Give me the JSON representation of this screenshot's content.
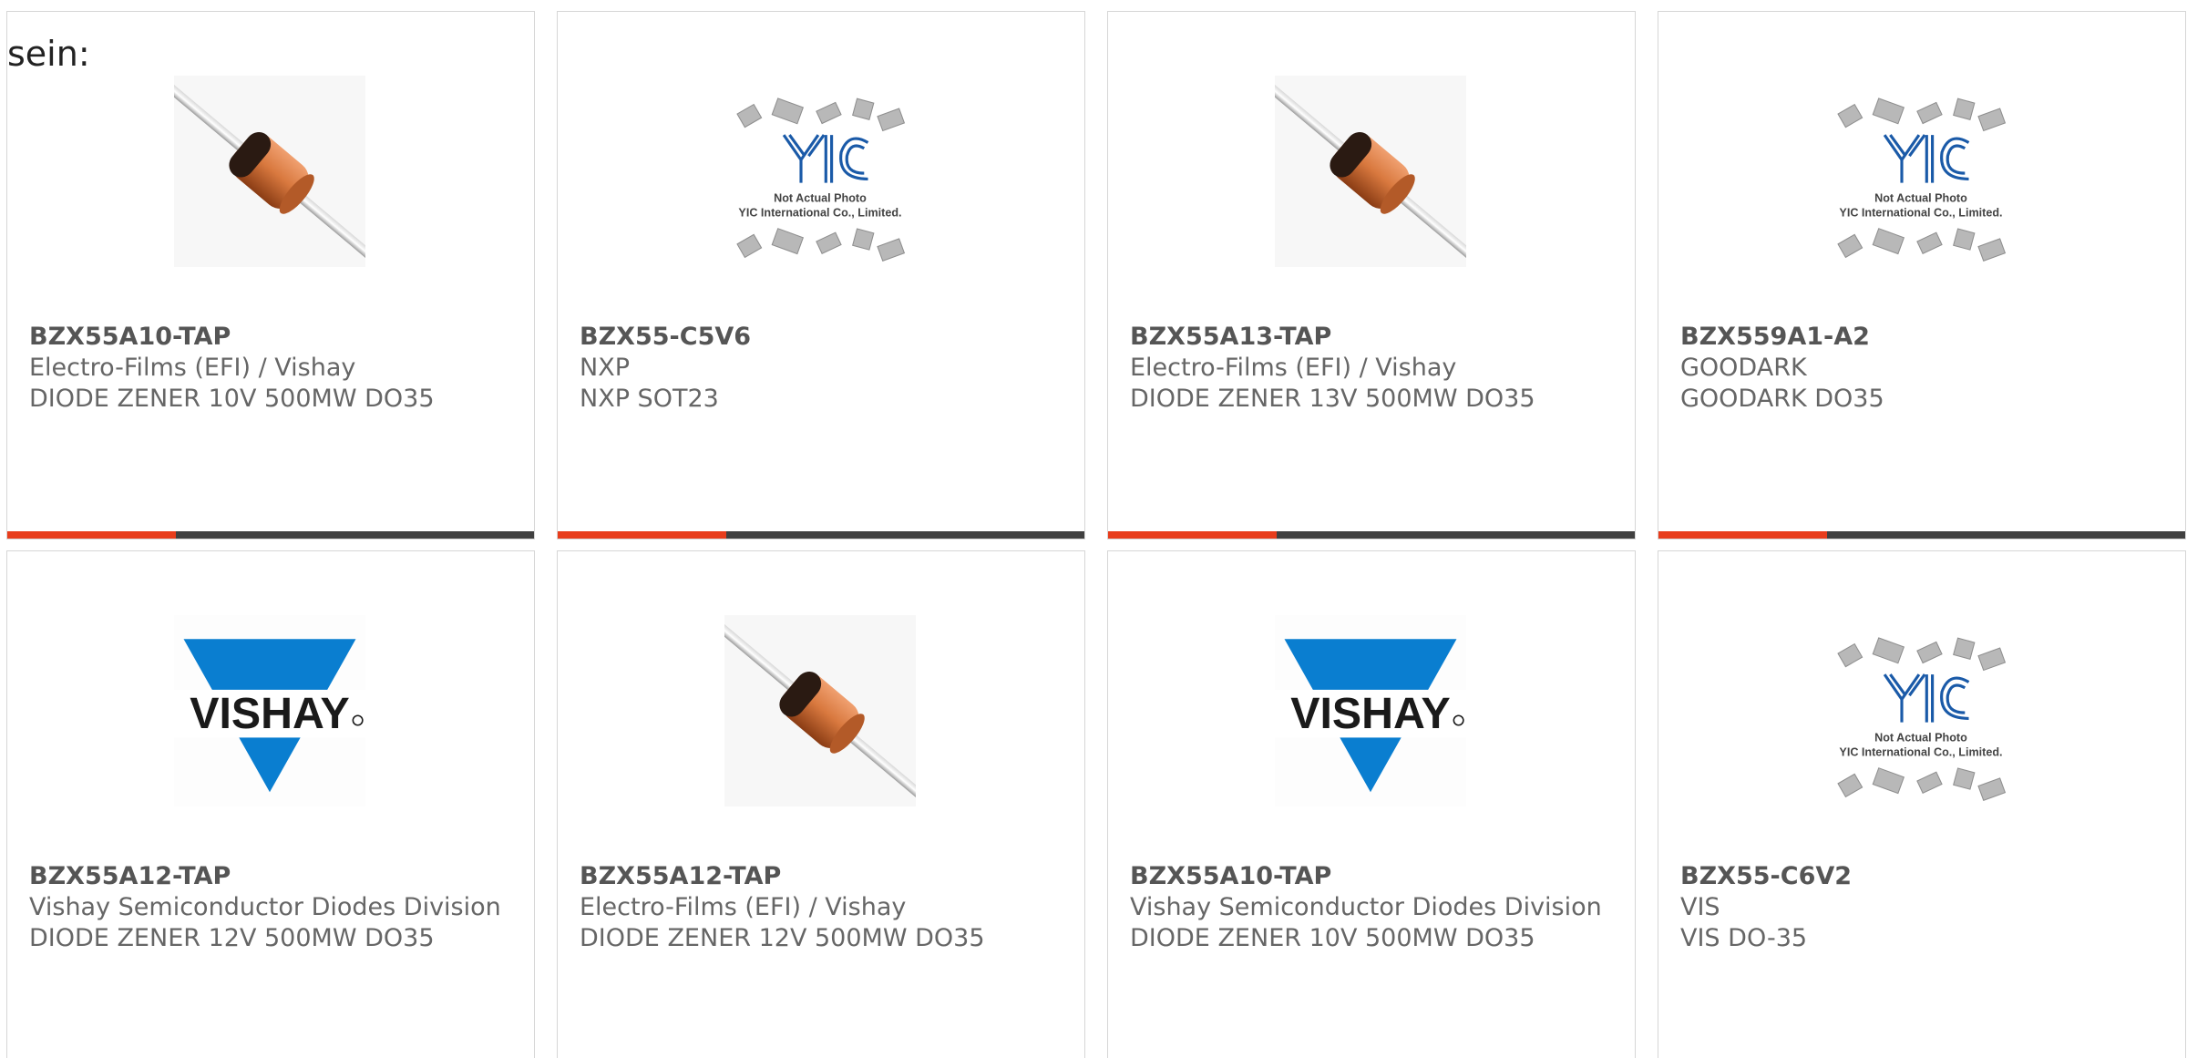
{
  "intro_text": "sein:",
  "colors": {
    "accent": "#e83d1c",
    "bar": "#404040",
    "vishay_blue": "#0a7ed0",
    "yic_blue": "#1a5aa8"
  },
  "cards": [
    {
      "image": "diode-photo",
      "part_number": "BZX55A10-TAP",
      "manufacturer": "Electro-Films (EFI) / Vishay",
      "description": "DIODE ZENER 10V 500MW DO35",
      "accent_fraction": 0.32
    },
    {
      "image": "yic-placeholder",
      "image_caption_1": "Not Actual Photo",
      "image_caption_2": "YIC International Co., Limited.",
      "part_number": "BZX55-C5V6",
      "manufacturer": "NXP",
      "description": "NXP SOT23",
      "accent_fraction": 0.32
    },
    {
      "image": "diode-photo",
      "part_number": "BZX55A13-TAP",
      "manufacturer": "Electro-Films (EFI) / Vishay",
      "description": "DIODE ZENER 13V 500MW DO35",
      "accent_fraction": 0.32
    },
    {
      "image": "yic-placeholder",
      "image_caption_1": "Not Actual Photo",
      "image_caption_2": "YIC International Co., Limited.",
      "part_number": "BZX559A1-A2",
      "manufacturer": "GOODARK",
      "description": "GOODARK DO35",
      "accent_fraction": 0.32
    },
    {
      "image": "vishay-logo",
      "image_caption_1": "VISHAY",
      "part_number": "BZX55A12-TAP",
      "manufacturer": "Vishay Semiconductor Diodes Division",
      "description": "DIODE ZENER 12V 500MW DO35",
      "accent_fraction": 0
    },
    {
      "image": "diode-photo",
      "part_number": "BZX55A12-TAP",
      "manufacturer": "Electro-Films (EFI) / Vishay",
      "description": "DIODE ZENER 12V 500MW DO35",
      "accent_fraction": 0
    },
    {
      "image": "vishay-logo",
      "image_caption_1": "VISHAY",
      "part_number": "BZX55A10-TAP",
      "manufacturer": "Vishay Semiconductor Diodes Division",
      "description": "DIODE ZENER 10V 500MW DO35",
      "accent_fraction": 0
    },
    {
      "image": "yic-placeholder",
      "image_caption_1": "Not Actual Photo",
      "image_caption_2": "YIC International Co., Limited.",
      "part_number": "BZX55-C6V2",
      "manufacturer": "VIS",
      "description": "VIS DO-35",
      "accent_fraction": 0
    }
  ]
}
